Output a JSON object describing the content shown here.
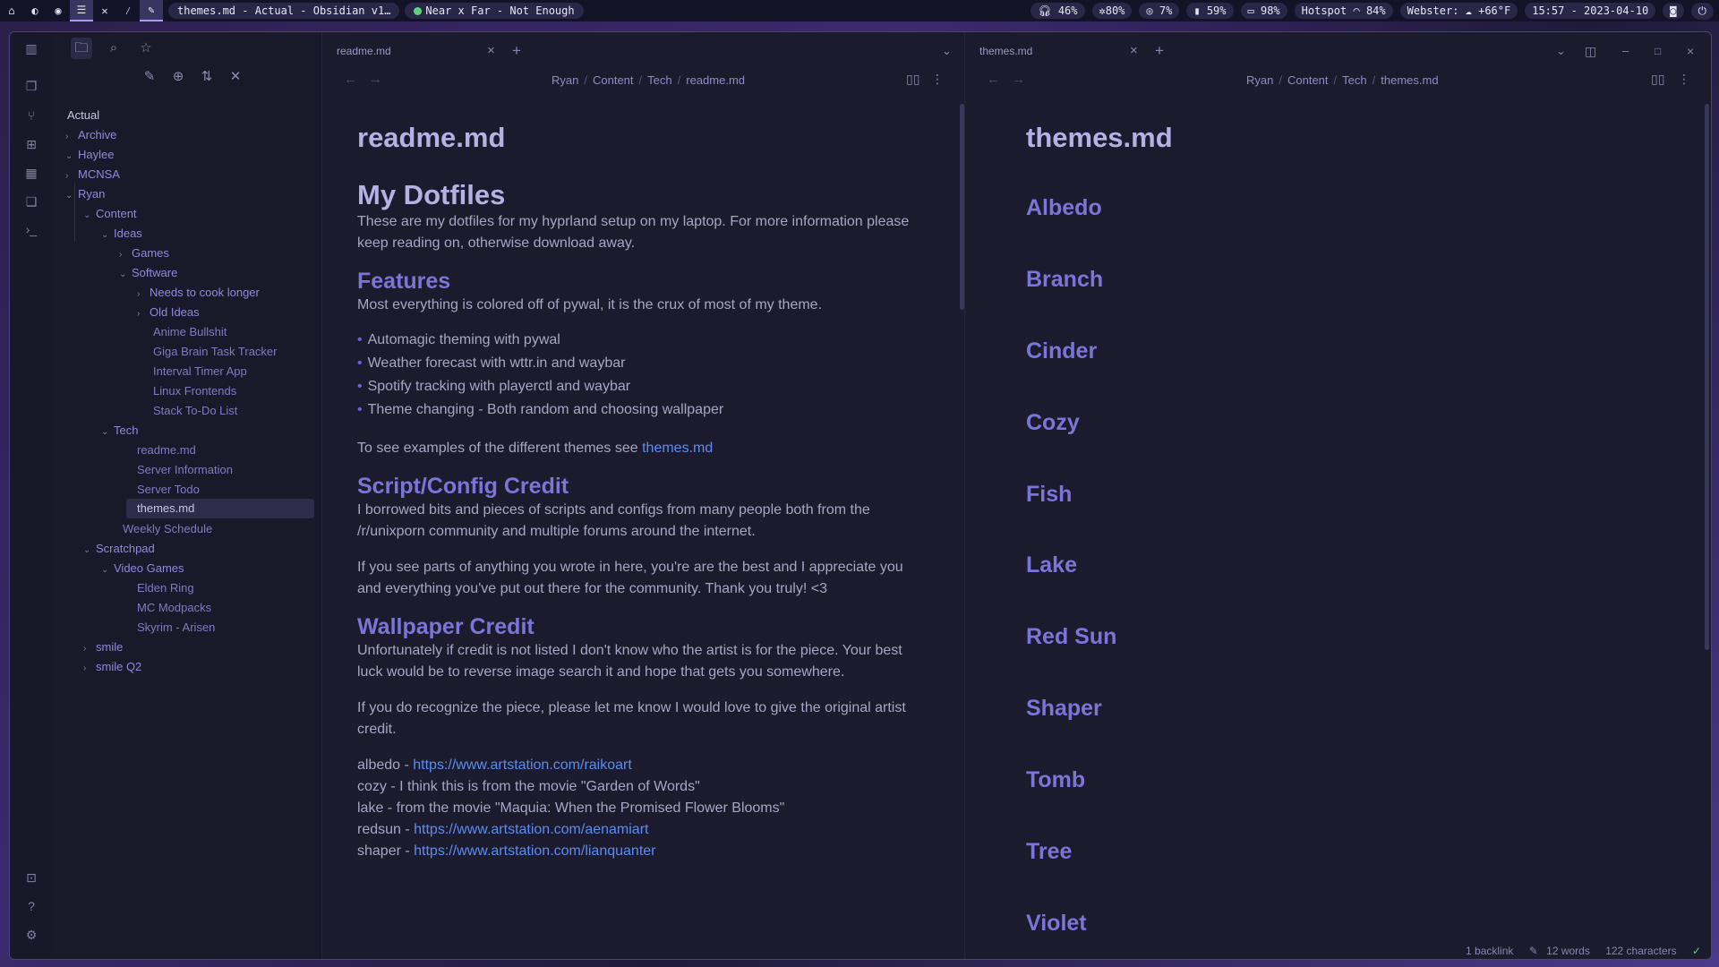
{
  "topbar": {
    "window_title": "themes.md - Actual - Obsidian v1…",
    "media": "Near x Far - Not Enough",
    "headphones": "46%",
    "cpu": "80%",
    "disk": "7%",
    "memory": "59%",
    "battery": "98%",
    "network": "Hotspot",
    "wifi": "84%",
    "weather": "Webster: ☁ +66°F",
    "clock": "15:57 - 2023-04-10"
  },
  "sidebar": {
    "vault": "Actual",
    "items": [
      {
        "label": "Archive"
      },
      {
        "label": "Haylee"
      },
      {
        "label": "MCNSA"
      },
      {
        "label": "Ryan"
      },
      {
        "label": "Content"
      },
      {
        "label": "Ideas"
      },
      {
        "label": "Games"
      },
      {
        "label": "Software"
      },
      {
        "label": "Needs to cook longer"
      },
      {
        "label": "Old Ideas"
      },
      {
        "label": "Anime Bullshit"
      },
      {
        "label": "Giga Brain Task Tracker"
      },
      {
        "label": "Interval Timer App"
      },
      {
        "label": "Linux Frontends"
      },
      {
        "label": "Stack To-Do List"
      },
      {
        "label": "Tech"
      },
      {
        "label": "readme.md"
      },
      {
        "label": "Server Information"
      },
      {
        "label": "Server Todo"
      },
      {
        "label": "themes.md"
      },
      {
        "label": "Weekly Schedule"
      },
      {
        "label": "Scratchpad"
      },
      {
        "label": "Video Games"
      },
      {
        "label": "Elden Ring"
      },
      {
        "label": "MC Modpacks"
      },
      {
        "label": "Skyrim - Arisen"
      },
      {
        "label": "smile"
      },
      {
        "label": "smile Q2"
      }
    ]
  },
  "left_pane": {
    "tab": "readme.md",
    "crumbs": [
      "Ryan",
      "Content",
      "Tech",
      "readme.md"
    ],
    "doc_title": "readme.md",
    "h1": "My Dotfiles",
    "intro": "These are my dotfiles for my hyprland setup on my laptop. For more information please keep reading on, otherwise download away.",
    "features_h": "Features",
    "features_p": "Most everything is colored off of pywal, it is the crux of most of my theme.",
    "bullets": [
      "Automagic theming with pywal",
      "Weather forecast with wttr.in and waybar",
      "Spotify tracking with playerctl and waybar",
      "Theme changing - Both random and choosing wallpaper"
    ],
    "see_text": "To see examples of the different themes see ",
    "see_link": "themes.md",
    "script_h": "Script/Config Credit",
    "script_p1": "I borrowed bits and pieces of scripts and configs from many people both from the /r/unixporn community and multiple forums around the internet.",
    "script_p2": "If you see parts of anything you wrote in here, you're are the best and I appreciate you and everything you've put out there for the community. Thank you truly! <3",
    "wall_h": "Wallpaper Credit",
    "wall_p1": "Unfortunately if credit is not listed I don't know who the artist is for the piece. Your best luck would be to reverse image search it and hope that gets you somewhere.",
    "wall_p2": "If you do recognize the piece, please let me know I would love to give the original artist credit.",
    "credits": [
      {
        "prefix": "albedo - ",
        "link": "https://www.artstation.com/raikoart",
        "text": ""
      },
      {
        "prefix": "",
        "link": "",
        "text": "cozy - I think this is from the movie \"Garden of Words\""
      },
      {
        "prefix": "",
        "link": "",
        "text": "lake - from the movie \"Maquia: When the Promised Flower Blooms\""
      },
      {
        "prefix": "redsun - ",
        "link": "https://www.artstation.com/aenamiart",
        "text": ""
      },
      {
        "prefix": "shaper - ",
        "link": "https://www.artstation.com/lianquanter",
        "text": ""
      }
    ]
  },
  "right_pane": {
    "tab": "themes.md",
    "crumbs": [
      "Ryan",
      "Content",
      "Tech",
      "themes.md"
    ],
    "doc_title": "themes.md",
    "themes": [
      "Albedo",
      "Branch",
      "Cinder",
      "Cozy",
      "Fish",
      "Lake",
      "Red Sun",
      "Shaper",
      "Tomb",
      "Tree",
      "Violet"
    ]
  },
  "status": {
    "backlinks": "1 backlink",
    "words": "12 words",
    "chars": "122 characters"
  }
}
